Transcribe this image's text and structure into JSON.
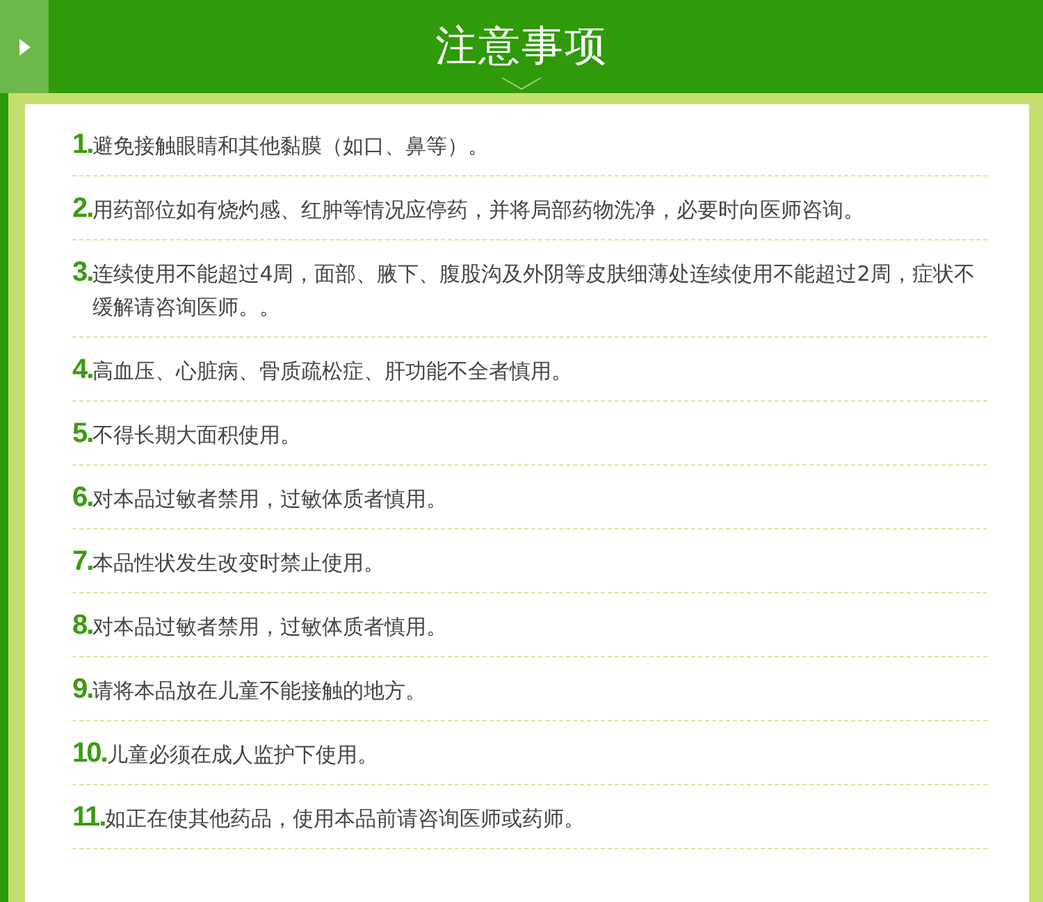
{
  "header": {
    "title": "注意事项"
  },
  "items": [
    {
      "number": "1.",
      "text": "避免接触眼睛和其他黏膜（如口、鼻等）。"
    },
    {
      "number": "2.",
      "text": "用药部位如有烧灼感、红肿等情况应停药，并将局部药物洗净，必要时向医师咨询。"
    },
    {
      "number": "3.",
      "text": "连续使用不能超过4周，面部、腋下、腹股沟及外阴等皮肤细薄处连续使用不能超过2周，症状不缓解请咨询医师。。"
    },
    {
      "number": "4.",
      "text": "高血压、心脏病、骨质疏松症、肝功能不全者慎用。"
    },
    {
      "number": "5.",
      "text": "不得长期大面积使用。"
    },
    {
      "number": "6.",
      "text": "对本品过敏者禁用，过敏体质者慎用。"
    },
    {
      "number": "7.",
      "text": "本品性状发生改变时禁止使用。"
    },
    {
      "number": "8.",
      "text": "对本品过敏者禁用，过敏体质者慎用。"
    },
    {
      "number": "9.",
      "text": "请将本品放在儿童不能接触的地方。"
    },
    {
      "number": "10.",
      "text": "儿童必须在成人监护下使用。"
    },
    {
      "number": "11.",
      "text": "如正在使其他药品，使用本品前请咨询医师或药师。"
    }
  ]
}
